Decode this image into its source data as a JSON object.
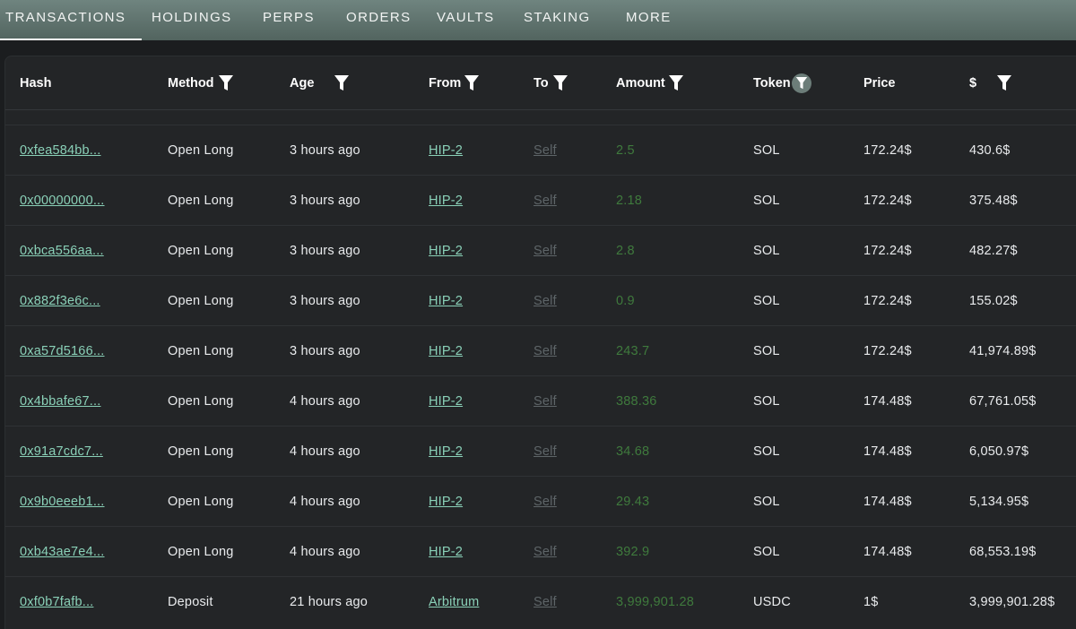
{
  "tabs": [
    {
      "label": "TRANSACTIONS",
      "active": true
    },
    {
      "label": "HOLDINGS",
      "active": false
    },
    {
      "label": "PERPS",
      "active": false
    },
    {
      "label": "ORDERS",
      "active": false
    },
    {
      "label": "VAULTS",
      "active": false
    },
    {
      "label": "STAKING",
      "active": false
    },
    {
      "label": "MORE",
      "active": false
    }
  ],
  "table": {
    "headers": {
      "hash": "Hash",
      "method": "Method",
      "age": "Age",
      "from": "From",
      "to": "To",
      "amount": "Amount",
      "token": "Token",
      "price": "Price",
      "usd": "$"
    },
    "filter_icon": "funnel-icon",
    "active_filter": "token",
    "rows": [
      {
        "hash": "0xfea584bb...",
        "method": "Open Long",
        "age": "3 hours ago",
        "from": "HIP-2",
        "to": "Self",
        "amount": "2.5",
        "token": "SOL",
        "price": "172.24$",
        "usd": "430.6$"
      },
      {
        "hash": "0x00000000...",
        "method": "Open Long",
        "age": "3 hours ago",
        "from": "HIP-2",
        "to": "Self",
        "amount": "2.18",
        "token": "SOL",
        "price": "172.24$",
        "usd": "375.48$"
      },
      {
        "hash": "0xbca556aa...",
        "method": "Open Long",
        "age": "3 hours ago",
        "from": "HIP-2",
        "to": "Self",
        "amount": "2.8",
        "token": "SOL",
        "price": "172.24$",
        "usd": "482.27$"
      },
      {
        "hash": "0x882f3e6c...",
        "method": "Open Long",
        "age": "3 hours ago",
        "from": "HIP-2",
        "to": "Self",
        "amount": "0.9",
        "token": "SOL",
        "price": "172.24$",
        "usd": "155.02$"
      },
      {
        "hash": "0xa57d5166...",
        "method": "Open Long",
        "age": "3 hours ago",
        "from": "HIP-2",
        "to": "Self",
        "amount": "243.7",
        "token": "SOL",
        "price": "172.24$",
        "usd": "41,974.89$"
      },
      {
        "hash": "0x4bbafe67...",
        "method": "Open Long",
        "age": "4 hours ago",
        "from": "HIP-2",
        "to": "Self",
        "amount": "388.36",
        "token": "SOL",
        "price": "174.48$",
        "usd": "67,761.05$"
      },
      {
        "hash": "0x91a7cdc7...",
        "method": "Open Long",
        "age": "4 hours ago",
        "from": "HIP-2",
        "to": "Self",
        "amount": "34.68",
        "token": "SOL",
        "price": "174.48$",
        "usd": "6,050.97$"
      },
      {
        "hash": "0x9b0eeeb1...",
        "method": "Open Long",
        "age": "4 hours ago",
        "from": "HIP-2",
        "to": "Self",
        "amount": "29.43",
        "token": "SOL",
        "price": "174.48$",
        "usd": "5,134.95$"
      },
      {
        "hash": "0xb43ae7e4...",
        "method": "Open Long",
        "age": "4 hours ago",
        "from": "HIP-2",
        "to": "Self",
        "amount": "392.9",
        "token": "SOL",
        "price": "174.48$",
        "usd": "68,553.19$"
      },
      {
        "hash": "0xf0b7fafb...",
        "method": "Deposit",
        "age": "21 hours ago",
        "from": "Arbitrum",
        "to": "Self",
        "amount": "3,999,901.28",
        "token": "USDC",
        "price": "1$",
        "usd": "3,999,901.28$"
      }
    ]
  },
  "colors": {
    "tabbar": "#5f736e",
    "panel": "#232527",
    "link": "#8ad1b8",
    "self_link": "#5e6568",
    "amount": "#3f7a3d"
  }
}
